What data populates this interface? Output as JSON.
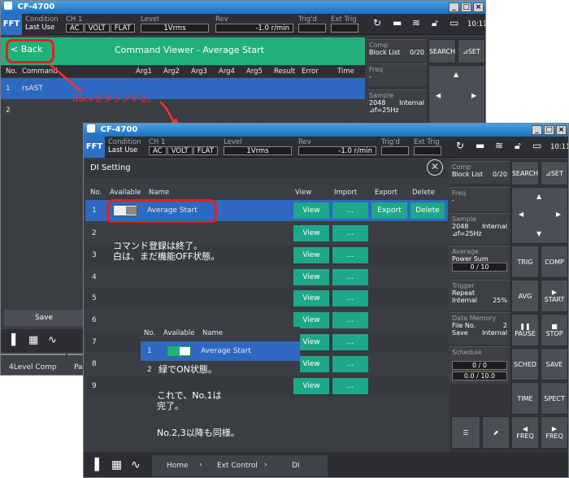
{
  "back_window": {
    "title": "CF-4700",
    "topbar": {
      "mode": "FFT",
      "condition_label": "Condition",
      "condition_value": "Last Use",
      "ch_label": "CH 1",
      "ch_boxes": [
        "AC",
        "VOLT",
        "FLAT"
      ],
      "level_label": "Level",
      "level_value": "1Vrms",
      "rev_label": "Rev",
      "rev_value": "-1.0 r/min",
      "trig_label": "Trig'd",
      "ext_trig_label": "Ext Trig",
      "time": "10:11"
    },
    "header": {
      "back_label": "< Back",
      "title": "Command Viewer -  Average Start"
    },
    "columns": [
      "No.",
      "Command",
      "Arg1",
      "Arg2",
      "Arg3",
      "Arg4",
      "Arg5",
      "Result",
      "Error",
      "Time"
    ],
    "rows": [
      {
        "no": "1",
        "command": "rsAST"
      },
      {
        "no": "2",
        "command": ""
      }
    ],
    "annotation": "Backをタップする。",
    "save_label": "Save",
    "level_comp_label": "4Level Comp",
    "pa_label": "Pa",
    "right": {
      "comp": "Comp",
      "block_list": "Block List",
      "block_count": "0/20",
      "freq": "Freq",
      "freq_value": "-",
      "sample": "Sample",
      "sample_value": "2048",
      "sample_mode": "Internal",
      "df": "⊿f=25Hz",
      "search": "SEARCH",
      "set": "⊿SET"
    }
  },
  "front_window": {
    "title": "CF-4700",
    "topbar": {
      "mode": "FFT",
      "condition_label": "Condition",
      "condition_value": "Last Use",
      "ch_label": "CH 1",
      "ch_boxes": [
        "AC",
        "VOLT",
        "FLAT"
      ],
      "level_label": "Level",
      "level_value": "1Vrms",
      "rev_label": "Rev",
      "rev_value": "-1.0 r/min",
      "trig_label": "Trig'd",
      "ext_trig_label": "Ext Trig",
      "time": "10:11"
    },
    "dialog_title": "DI Setting",
    "columns": [
      "No.",
      "Available",
      "Name",
      "View",
      "Import",
      "Export",
      "Delete"
    ],
    "row1": {
      "no": "1",
      "name": "Average Start",
      "view": "View",
      "import": "...",
      "export": "Export",
      "delete": "Delete"
    },
    "row_numbers": [
      "2",
      "3",
      "4",
      "5",
      "6",
      "7",
      "8",
      "9"
    ],
    "view_label": "View",
    "import_label": "...",
    "note1": "コマンド登録は終了。\n白は、まだ機能OFF状態。",
    "inset": {
      "columns": [
        "No.",
        "Available",
        "Name"
      ],
      "no": "1",
      "name": "Average Start",
      "next_no": "2"
    },
    "note2": "緑でON状態。",
    "note3": "これで、No.1は\n完了。",
    "note4": "No.2,3以降も同様。",
    "right": {
      "comp": "Comp",
      "block_list": "Block List",
      "block_count": "0/20",
      "freq": "Freq",
      "freq_value": "-",
      "sample": "Sample",
      "sample_value": "2048",
      "sample_mode": "Internal",
      "df": "⊿f=25Hz",
      "average": "Average",
      "power_sum": "Power Sum",
      "avg_count": "0 / 10",
      "trigger": "Trigger",
      "repeat": "Repeat",
      "internal": "Internal",
      "trig_pct": "25%",
      "data_memory": "Data Memory",
      "file_no": "File No.",
      "file_value": "2",
      "save": "Save",
      "save_mode": "Internal",
      "schedule": "Schedule",
      "sched1": "0 / 0",
      "sched2": "0.0 / 10.0",
      "buttons": {
        "search": "SEARCH",
        "set": "⊿SET",
        "trig": "TRIG",
        "comp": "COMP",
        "avg": "AVG",
        "start": "START",
        "pause": "PAUSE",
        "stop": "STOP",
        "sched": "SCHED",
        "save": "SAVE",
        "time": "TIME",
        "spect": "SPECT",
        "freq": "FREQ"
      }
    },
    "breadcrumb": [
      "Home",
      "Ext Control",
      "DI"
    ]
  },
  "colors": {
    "accent_green": "#22b07a",
    "selected_blue": "#2e68c0",
    "view_teal": "#1ea88a",
    "annotation_red": "#ff2a2a"
  }
}
